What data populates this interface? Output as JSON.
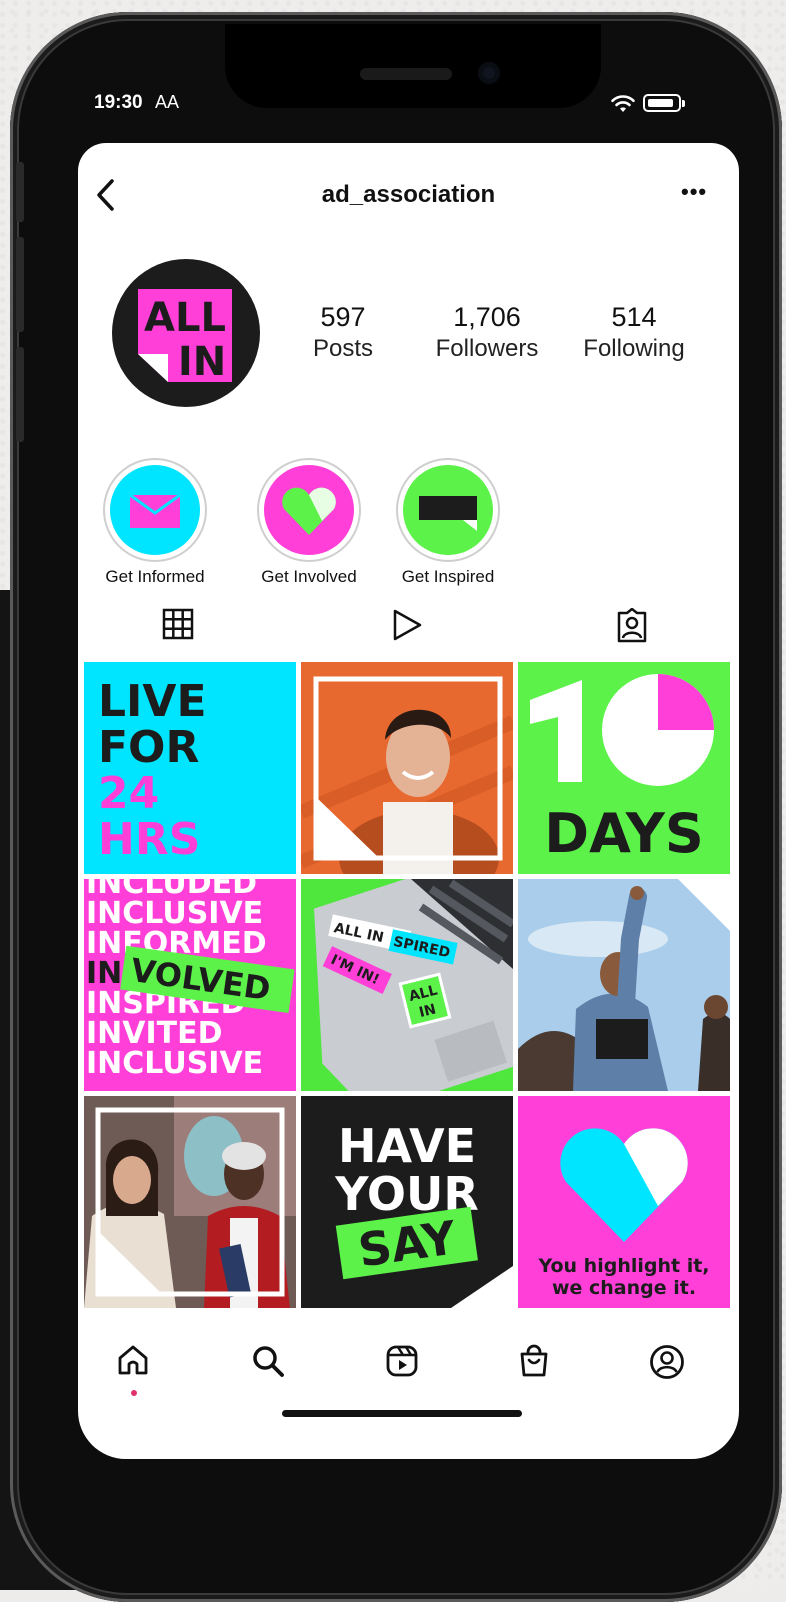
{
  "status_bar": {
    "time": "19:30",
    "text_size": "AA"
  },
  "header": {
    "username": "ad_association"
  },
  "profile": {
    "avatar_line1": "ALL",
    "avatar_line2": "IN",
    "stats": [
      {
        "value": "597",
        "label": "Posts"
      },
      {
        "value": "1,706",
        "label": "Followers"
      },
      {
        "value": "514",
        "label": "Following"
      }
    ]
  },
  "highlights": [
    {
      "label": "Get Informed",
      "icon": "envelope-icon"
    },
    {
      "label": "Get Involved",
      "icon": "heart-icon"
    },
    {
      "label": "Get Inspired",
      "icon": "speech-box-icon"
    }
  ],
  "tabs": [
    "grid-icon",
    "reels-play-icon",
    "tagged-person-icon"
  ],
  "posts": {
    "p1": [
      "LIVE",
      "FOR",
      "24",
      "HRS"
    ],
    "p3": {
      "number": "10",
      "word": "DAYS"
    },
    "p4": [
      "INCLUDED",
      "INCLUSIVE",
      "INFORMED",
      "IN",
      "VOLVED",
      "INSPIRED",
      "INVITED",
      "INCLUSIVE"
    ],
    "p5": {
      "s1": "ALL IN",
      "s2": "SPIRED",
      "s3": "I'M IN!",
      "s4": "ALL",
      "s5": "IN"
    },
    "p8": [
      "HAVE",
      "YOUR",
      "SAY"
    ],
    "p9": [
      "You highlight it,",
      "we change it."
    ]
  },
  "bottom_nav": [
    "home-icon",
    "search-icon",
    "reels-icon",
    "shop-icon",
    "profile-icon"
  ],
  "colors": {
    "cyan": "#00e5ff",
    "pink": "#ff3fd7",
    "green": "#5cf24a",
    "black": "#1c1c1c",
    "orange": "#e8692f"
  }
}
